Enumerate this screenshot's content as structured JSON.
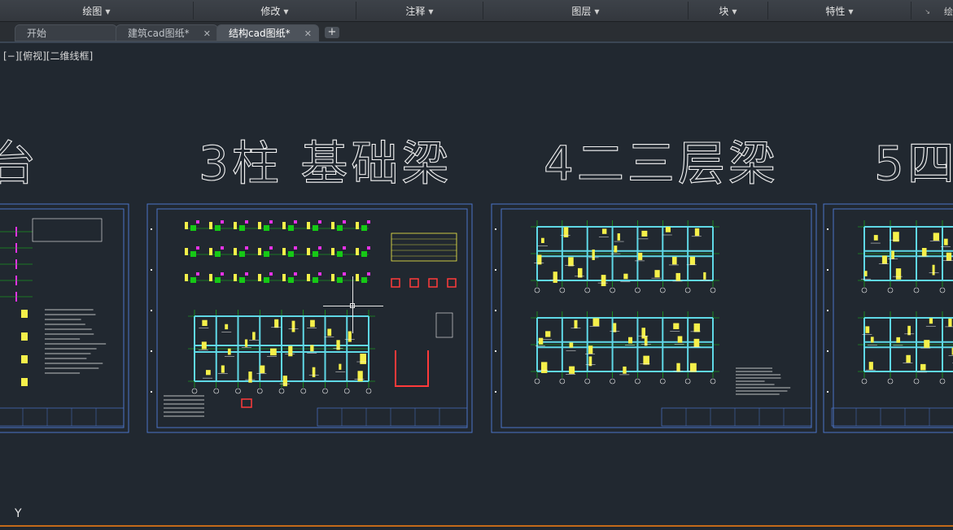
{
  "ribbon": {
    "panels": [
      {
        "label": "绘图",
        "caret": "▼"
      },
      {
        "label": "修改",
        "caret": "▼"
      },
      {
        "label": "注释",
        "caret": "▼"
      },
      {
        "label": "图层",
        "caret": "▼"
      },
      {
        "label": "块",
        "caret": "▼"
      },
      {
        "label": "特性",
        "caret": "▼"
      }
    ],
    "truncated_right": "绘"
  },
  "tabs": [
    {
      "label": "开始",
      "close": ""
    },
    {
      "label": "建筑cad图纸*",
      "close": "✕"
    },
    {
      "label": "结构cad图纸*",
      "close": "✕"
    }
  ],
  "new_tab": "+",
  "viewport_label": "[−][俯视][二维线框]",
  "drawing_titles": [
    "台",
    "3柱 基础梁",
    "4二三层梁",
    "5四"
  ],
  "ucs_label": "Y",
  "colors": {
    "background": "#212830",
    "frame": "#4b74c9",
    "beam": "#5fd8e6",
    "grid": "#16c916",
    "annotation": "#f5f04a",
    "highlight": "#e632e6",
    "text": "#f2f2f2"
  }
}
